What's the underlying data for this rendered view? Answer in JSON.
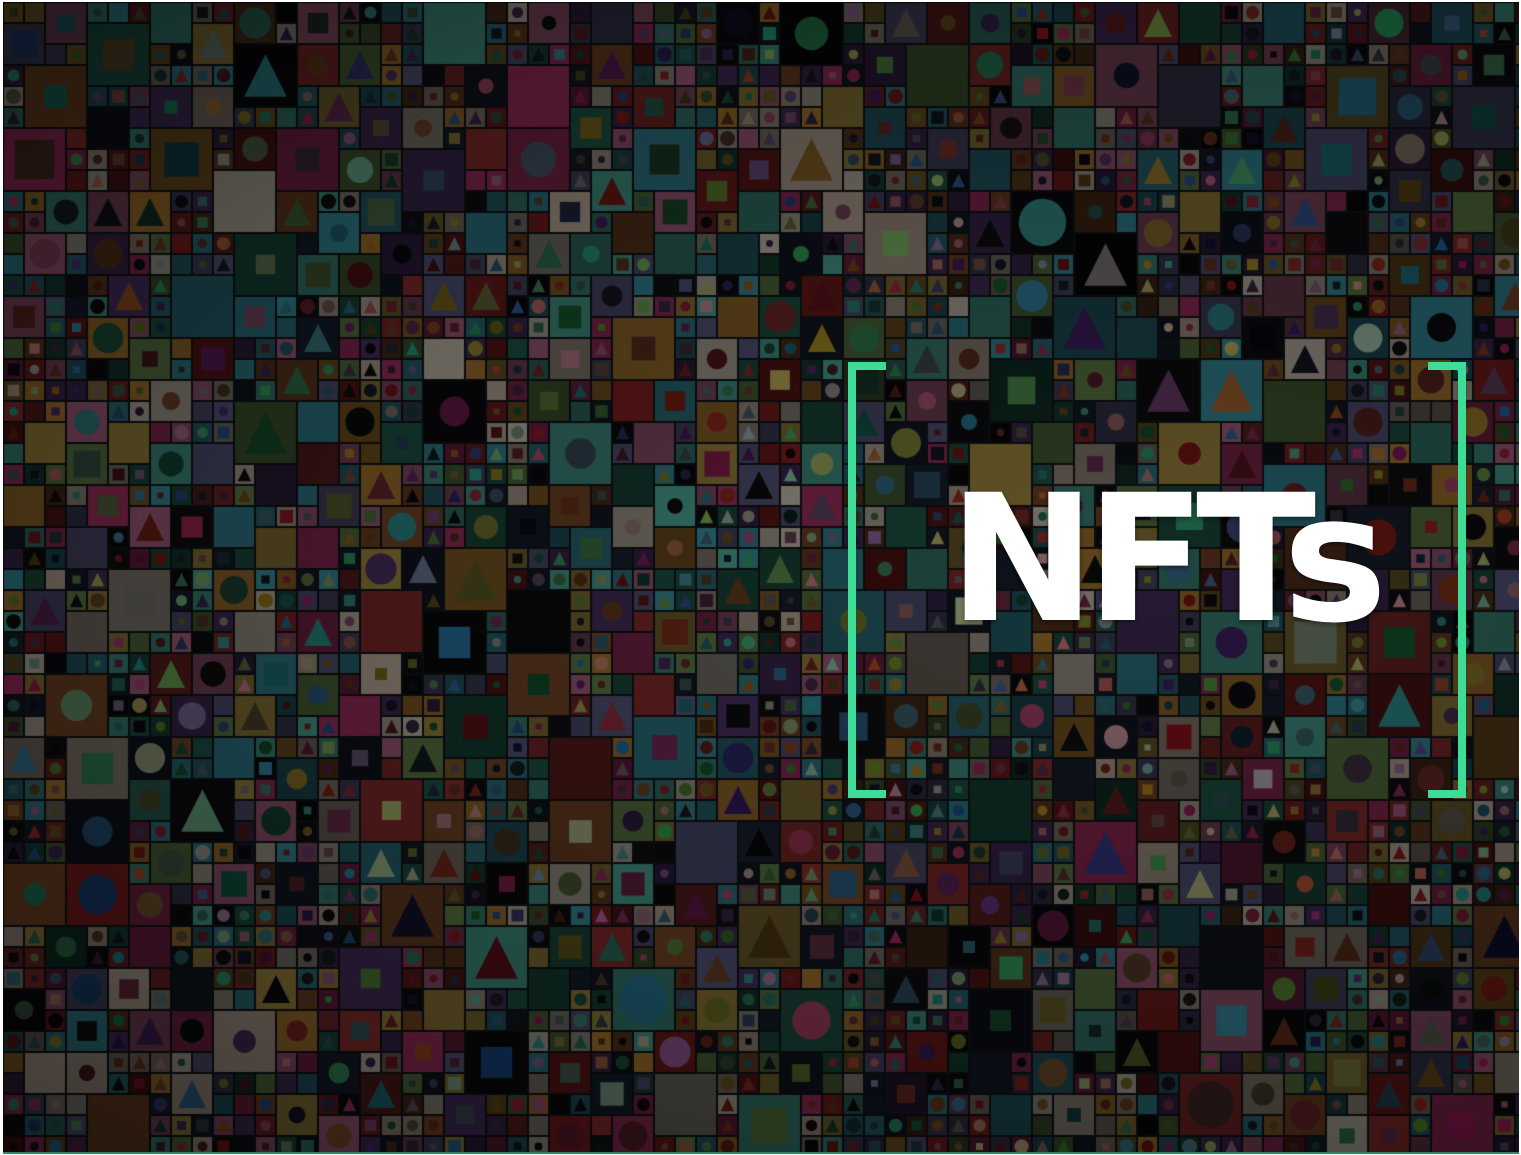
{
  "hero": {
    "title": "NFTs",
    "background": "collage-of-nft-artwork-thumbnails",
    "accent_color": "#3ddc97",
    "title_color": "#ffffff",
    "base_color": "#1a1f22"
  }
}
